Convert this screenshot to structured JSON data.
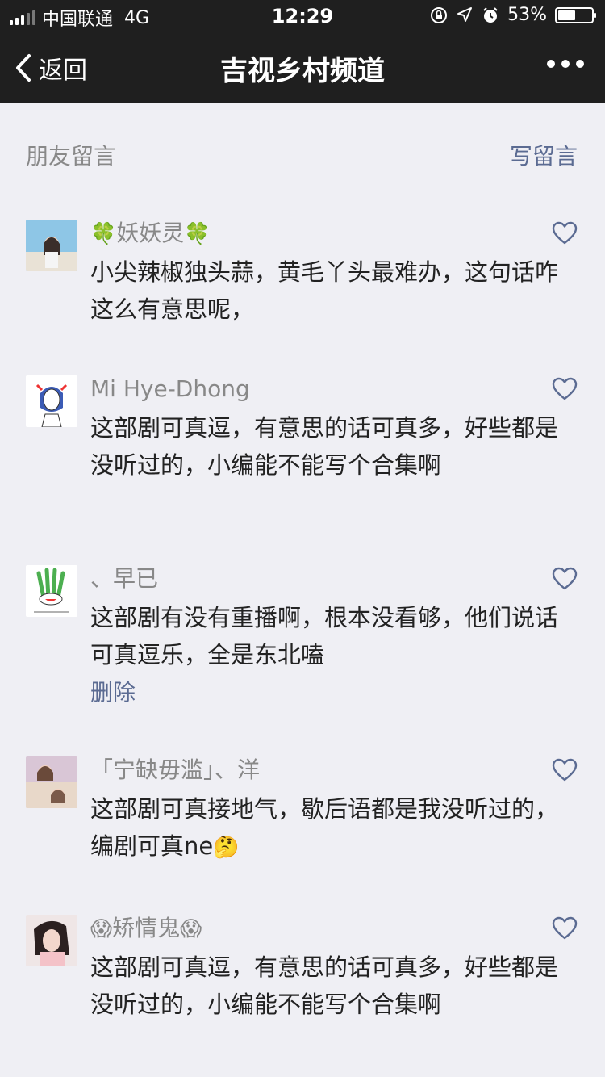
{
  "status_bar": {
    "carrier": "中国联通",
    "network": "4G",
    "time": "12:29",
    "battery": "53%",
    "battery_level": 0.53
  },
  "nav": {
    "back_label": "返回",
    "title": "吉视乡村频道",
    "more_icon": "more-icon"
  },
  "section": {
    "title": "朋友留言",
    "write_label": "写留言"
  },
  "comments": [
    {
      "nickname_prefix": "🍀",
      "nickname": "妖妖灵",
      "nickname_suffix": "🍀",
      "text": "小尖辣椒独头蒜，黄毛丫头最难办，这句话咋这么有意思呢，"
    },
    {
      "nickname": "Mi Hye-Dhong",
      "text": "这部剧可真逗，有意思的话可真多，好些都是没听过的，小编能不能写个合集啊"
    },
    {
      "nickname": "、早已",
      "text": "这部剧有没有重播啊，根本没看够，他们说话可真逗乐，全是东北嗑",
      "delete_label": "删除"
    },
    {
      "nickname": "「宁缺毋滥」、洋",
      "text": "这部剧可真接地气，歇后语都是我没听过的，编剧可真ne",
      "text_emoji": "🤔"
    },
    {
      "nickname_prefix": "😱",
      "nickname": "矫情鬼",
      "nickname_suffix": "😱",
      "text": "这部剧可真逗，有意思的话可真多，好些都是没听过的，小编能不能写个合集啊"
    }
  ],
  "colors": {
    "navbar_bg": "#1f1f1f",
    "page_bg": "#efeff4",
    "link": "#5b6b92",
    "heart": "#5b6b92"
  }
}
